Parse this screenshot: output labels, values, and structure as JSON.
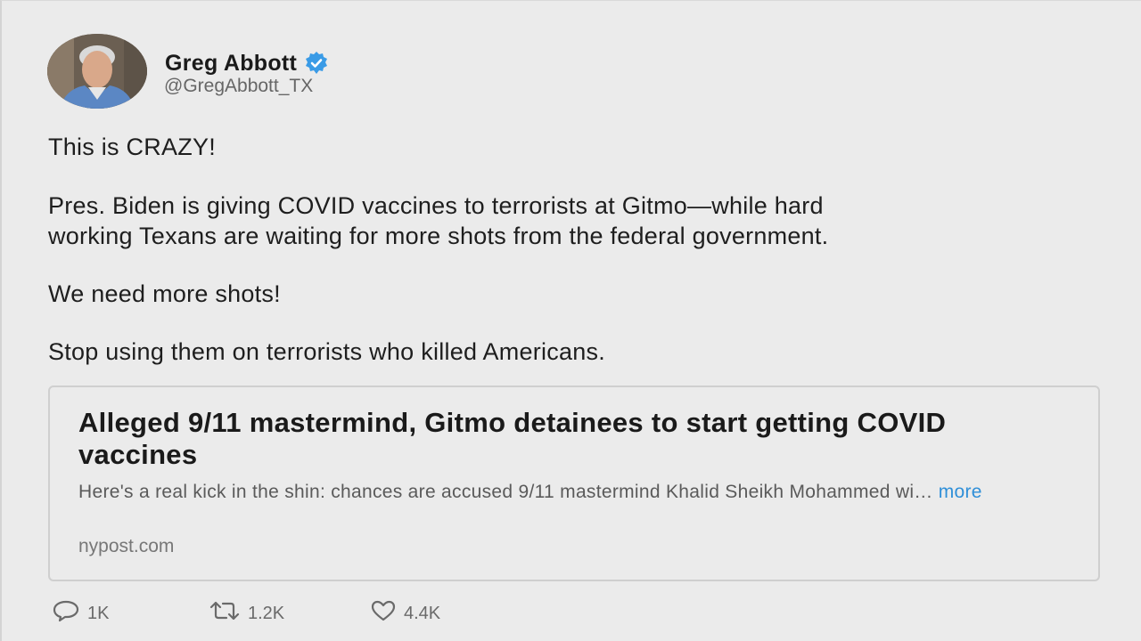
{
  "author": {
    "name": "Greg Abbott",
    "handle": "@GregAbbott_TX",
    "verified_icon": "verified-badge-icon",
    "verified_color": "#3a9be6"
  },
  "tweet": {
    "line1": "This is CRAZY!",
    "line2": "Pres. Biden is giving COVID vaccines to terrorists at Gitmo—while hard",
    "line3": "working Texans are waiting for more shots from the federal government.",
    "line4": "We need more shots!",
    "line5": "Stop using them on terrorists who killed Americans."
  },
  "card": {
    "title": "Alleged 9/11 mastermind, Gitmo detainees to start getting COVID vaccines",
    "description": "Here's a real kick in the shin: chances are accused 9/11 mastermind Khalid Sheikh Mohammed wi… ",
    "more_label": "more",
    "domain": "nypost.com",
    "link_color": "#2f8fd8"
  },
  "actions": {
    "reply_count": "1K",
    "retweet_count": "1.2K",
    "like_count": "4.4K",
    "reply_icon": "reply-icon",
    "retweet_icon": "retweet-icon",
    "like_icon": "heart-icon"
  }
}
